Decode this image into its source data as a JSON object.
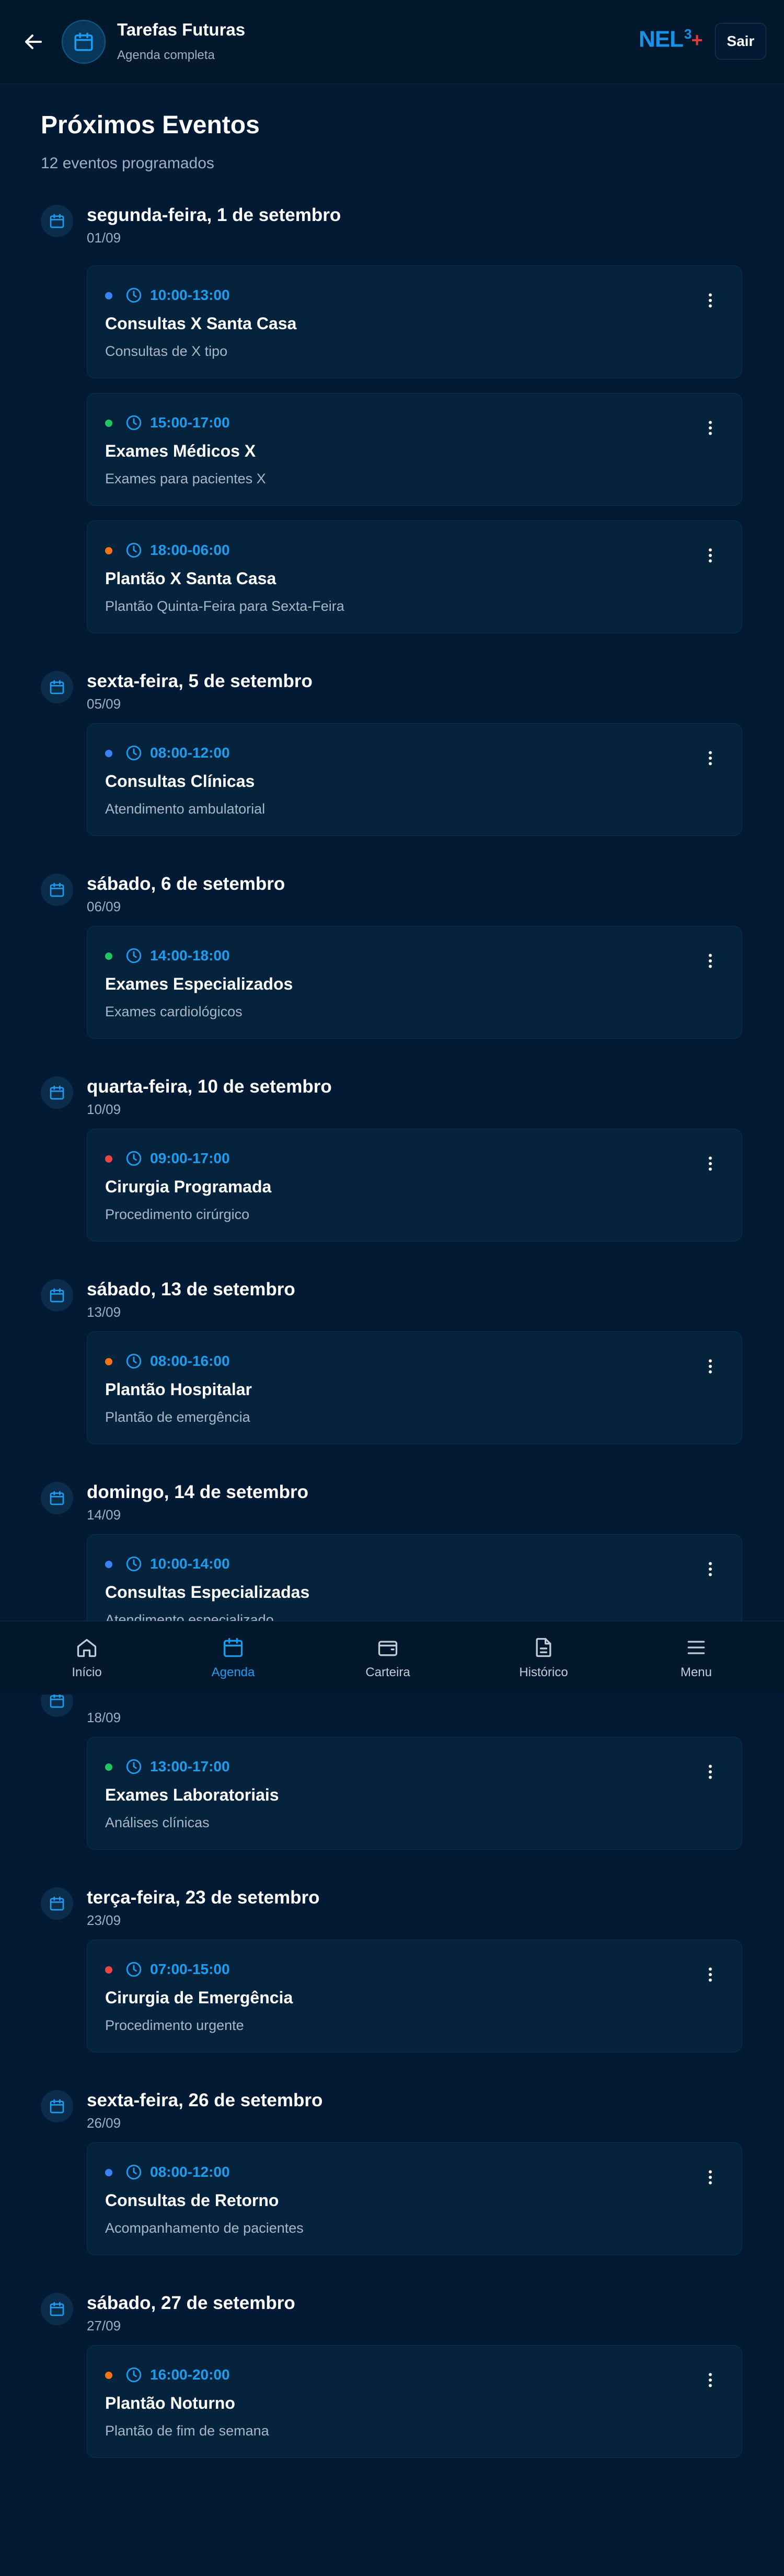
{
  "header": {
    "back_icon": "arrow-left-icon",
    "icon": "calendar-icon",
    "title": "Tarefas Futuras",
    "subtitle": "Agenda completa",
    "logo": {
      "text": "NEL",
      "sup": "3",
      "plus": "+"
    },
    "exit_label": "Sair"
  },
  "page": {
    "title": "Próximos Eventos",
    "subtitle": "12 eventos programados"
  },
  "colors": {
    "accent": "#1d9df0",
    "blue_dot": "#3b82f6",
    "green_dot": "#22c55e",
    "orange_dot": "#f97316",
    "red_dot": "#ef4444"
  },
  "days": [
    {
      "title": "segunda-feira, 1 de setembro",
      "date": "01/09"
    },
    {
      "title": "sexta-feira, 5 de setembro",
      "date": "05/09"
    },
    {
      "title": "sábado, 6 de setembro",
      "date": "06/09"
    },
    {
      "title": "quarta-feira, 10 de setembro",
      "date": "10/09"
    },
    {
      "title": "sábado, 13 de setembro",
      "date": "13/09"
    },
    {
      "title": "domingo, 14 de setembro",
      "date": "14/09"
    },
    {
      "title": "",
      "date": "18/09"
    },
    {
      "title": "terça-feira, 23 de setembro",
      "date": "23/09"
    },
    {
      "title": "sexta-feira, 26 de setembro",
      "date": "26/09"
    },
    {
      "title": "sábado, 27 de setembro",
      "date": "27/09"
    }
  ],
  "events": [
    {
      "time": "10:00-13:00",
      "title": "Consultas X Santa Casa",
      "desc": "Consultas de X tipo",
      "dot": "#3b82f6"
    },
    {
      "time": "15:00-17:00",
      "title": "Exames Médicos X",
      "desc": "Exames para pacientes X",
      "dot": "#22c55e"
    },
    {
      "time": "18:00-06:00",
      "title": "Plantão X Santa Casa",
      "desc": "Plantão Quinta-Feira para Sexta-Feira",
      "dot": "#f97316"
    },
    {
      "time": "08:00-12:00",
      "title": "Consultas Clínicas",
      "desc": "Atendimento ambulatorial",
      "dot": "#3b82f6"
    },
    {
      "time": "14:00-18:00",
      "title": "Exames Especializados",
      "desc": "Exames cardiológicos",
      "dot": "#22c55e"
    },
    {
      "time": "09:00-17:00",
      "title": "Cirurgia Programada",
      "desc": "Procedimento cirúrgico",
      "dot": "#ef4444"
    },
    {
      "time": "08:00-16:00",
      "title": "Plantão Hospitalar",
      "desc": "Plantão de emergência",
      "dot": "#f97316"
    },
    {
      "time": "10:00-14:00",
      "title": "Consultas Especializadas",
      "desc": "Atendimento especializado",
      "dot": "#3b82f6"
    },
    {
      "time": "13:00-17:00",
      "title": "Exames Laboratoriais",
      "desc": "Análises clínicas",
      "dot": "#22c55e"
    },
    {
      "time": "07:00-15:00",
      "title": "Cirurgia de Emergência",
      "desc": "Procedimento urgente",
      "dot": "#ef4444"
    },
    {
      "time": "08:00-12:00",
      "title": "Consultas de Retorno",
      "desc": "Acompanhamento de pacientes",
      "dot": "#3b82f6"
    },
    {
      "time": "16:00-20:00",
      "title": "Plantão Noturno",
      "desc": "Plantão de fim de semana",
      "dot": "#f97316"
    }
  ],
  "nav": [
    {
      "label": "Início",
      "icon": "home-icon",
      "active": false
    },
    {
      "label": "Agenda",
      "icon": "calendar-icon",
      "active": true
    },
    {
      "label": "Carteira",
      "icon": "wallet-icon",
      "active": false
    },
    {
      "label": "Histórico",
      "icon": "document-icon",
      "active": false
    },
    {
      "label": "Menu",
      "icon": "menu-icon",
      "active": false
    }
  ]
}
